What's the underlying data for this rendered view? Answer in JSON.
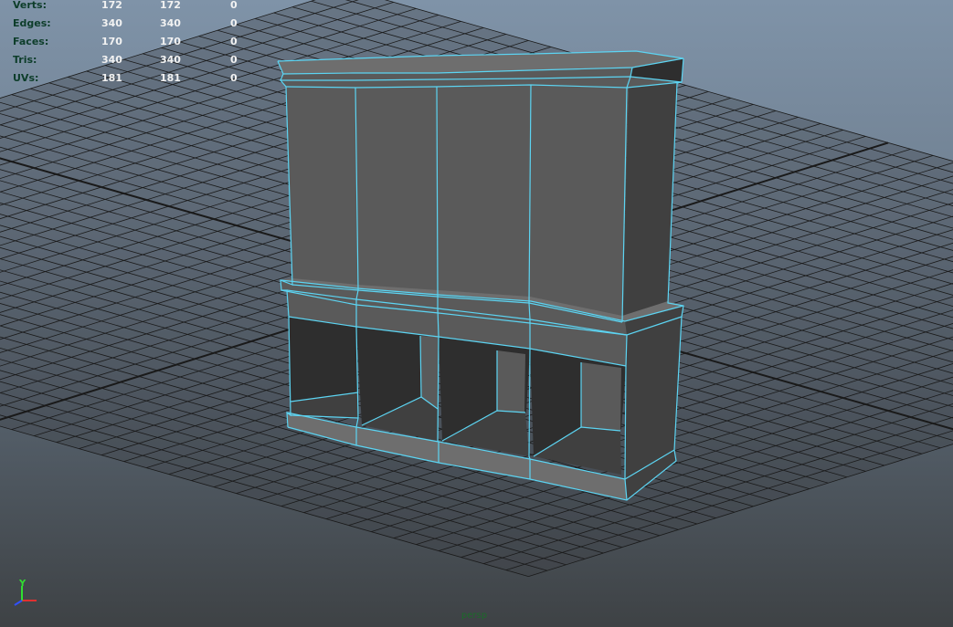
{
  "hud": {
    "rows": [
      {
        "label": "Verts:",
        "c1": "172",
        "c2": "172",
        "c3": "0"
      },
      {
        "label": "Edges:",
        "c1": "340",
        "c2": "340",
        "c3": "0"
      },
      {
        "label": "Faces:",
        "c1": "170",
        "c2": "170",
        "c3": "0"
      },
      {
        "label": "Tris:",
        "c1": "340",
        "c2": "340",
        "c3": "0"
      },
      {
        "label": "UVs:",
        "c1": "181",
        "c2": "181",
        "c3": "0"
      }
    ]
  },
  "axis_gizmo": {
    "y_label": "Y",
    "x_color": "#e03030",
    "y_color": "#30e030",
    "z_color": "#3050ff"
  },
  "camera_name": "persp",
  "colors": {
    "wireframe": "#5cd4f2",
    "grid": "#1a1a1a",
    "face_front": "#5a5a5a",
    "face_side": "#404040"
  }
}
